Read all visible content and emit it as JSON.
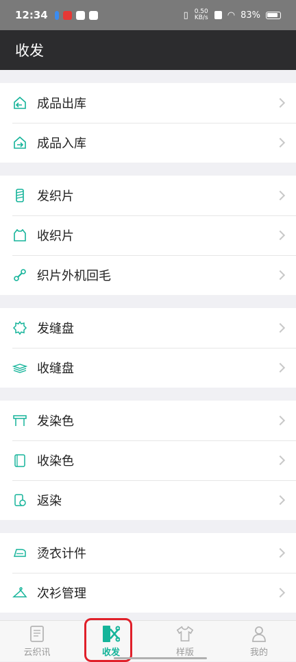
{
  "status": {
    "time": "12:34",
    "net_speed": "0.50 KB/s",
    "battery": "83%"
  },
  "header": {
    "title": "收发"
  },
  "groups": [
    {
      "items": [
        {
          "label": "成品出库",
          "icon": "exit-icon"
        },
        {
          "label": "成品入库",
          "icon": "enter-icon"
        }
      ]
    },
    {
      "items": [
        {
          "label": "发织片",
          "icon": "spool-icon"
        },
        {
          "label": "收织片",
          "icon": "sweater-icon"
        },
        {
          "label": "织片外机回毛",
          "icon": "yarn-link-icon"
        }
      ]
    },
    {
      "items": [
        {
          "label": "发缝盘",
          "icon": "gear-icon"
        },
        {
          "label": "收缝盘",
          "icon": "stack-icon"
        }
      ]
    },
    {
      "items": [
        {
          "label": "发染色",
          "icon": "dye-icon"
        },
        {
          "label": "收染色",
          "icon": "dye-roll-icon"
        },
        {
          "label": "返染",
          "icon": "redye-icon"
        }
      ]
    },
    {
      "items": [
        {
          "label": "烫衣计件",
          "icon": "iron-icon"
        },
        {
          "label": "次衫管理",
          "icon": "hanger-icon"
        }
      ]
    }
  ],
  "tabs": [
    {
      "label": "云织讯",
      "icon": "document-icon"
    },
    {
      "label": "收发",
      "icon": "scissors-icon",
      "active": true
    },
    {
      "label": "样版",
      "icon": "shirt-icon"
    },
    {
      "label": "我的",
      "icon": "person-icon"
    }
  ],
  "colors": {
    "accent": "#15b49a",
    "header": "#2c2c2e",
    "highlight": "#e0202a"
  }
}
